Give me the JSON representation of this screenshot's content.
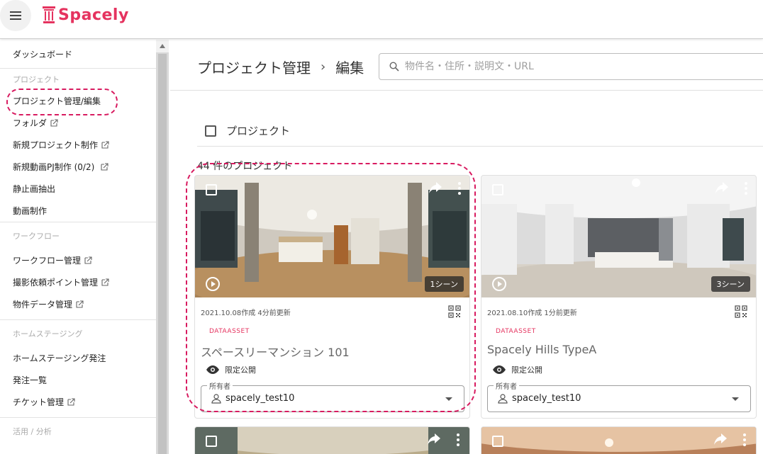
{
  "header": {
    "app_name": "Spacely",
    "brand_color": "#e5335f"
  },
  "sidebar": {
    "dashboard": "ダッシュボード",
    "section_project": "プロジェクト",
    "project_manage": "プロジェクト管理/編集",
    "folder": "フォルダ",
    "new_project": "新規プロジェクト制作",
    "new_video_pj": "新規動画PJ制作 (0/2)",
    "still_extract": "静止画抽出",
    "video_make": "動画制作",
    "section_workflow": "ワークフロー",
    "workflow_manage": "ワークフロー管理",
    "shoot_points": "撮影依頼ポイント管理",
    "property_data": "物件データ管理",
    "section_staging": "ホームステージング",
    "staging_order": "ホームステージング発注",
    "order_list": "発注一覧",
    "ticket_manage": "チケット管理",
    "section_analytics": "活用 / 分析"
  },
  "main": {
    "breadcrumb_root": "プロジェクト管理",
    "breadcrumb_sep": "›",
    "breadcrumb_current": "編集",
    "search_placeholder": "物件名・住所・説明文・URL",
    "select_all_label": "プロジェクト",
    "project_count": "44 件のプロジェクト"
  },
  "cards": [
    {
      "meta": "2021.10.08作成 4分前更新",
      "tag": "DATAASSET",
      "name": "スペースリーマンション 101",
      "visibility": "限定公開",
      "owner_label": "所有者",
      "owner": "spacely_test10",
      "scenes": "1シーン"
    },
    {
      "meta": "2021.08.10作成 1分前更新",
      "tag": "DATAASSET",
      "name": "Spacely Hills TypeA",
      "visibility": "限定公開",
      "owner_label": "所有者",
      "owner": "spacely_test10",
      "scenes": "3シーン"
    }
  ]
}
